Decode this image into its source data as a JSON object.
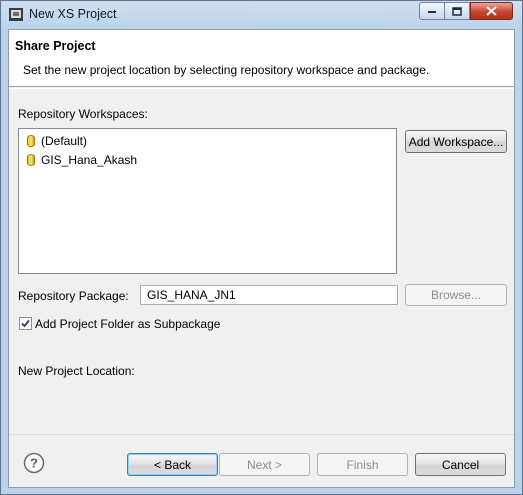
{
  "window": {
    "title": "New XS Project"
  },
  "banner": {
    "title": "Share Project",
    "message": "Set the new project location by selecting repository workspace and package."
  },
  "workspaces": {
    "label": "Repository Workspaces:",
    "items": [
      {
        "label": "(Default)"
      },
      {
        "label": "GIS_Hana_Akash"
      }
    ],
    "add_button": "Add Workspace..."
  },
  "package": {
    "label": "Repository Package:",
    "value": "GIS_HANA_JN1",
    "browse_button": "Browse..."
  },
  "subpackage": {
    "label": "Add Project Folder as Subpackage",
    "checked": true
  },
  "location": {
    "label": "New Project Location:"
  },
  "footer": {
    "back": "< Back",
    "next": "Next >",
    "finish": "Finish",
    "cancel": "Cancel"
  }
}
